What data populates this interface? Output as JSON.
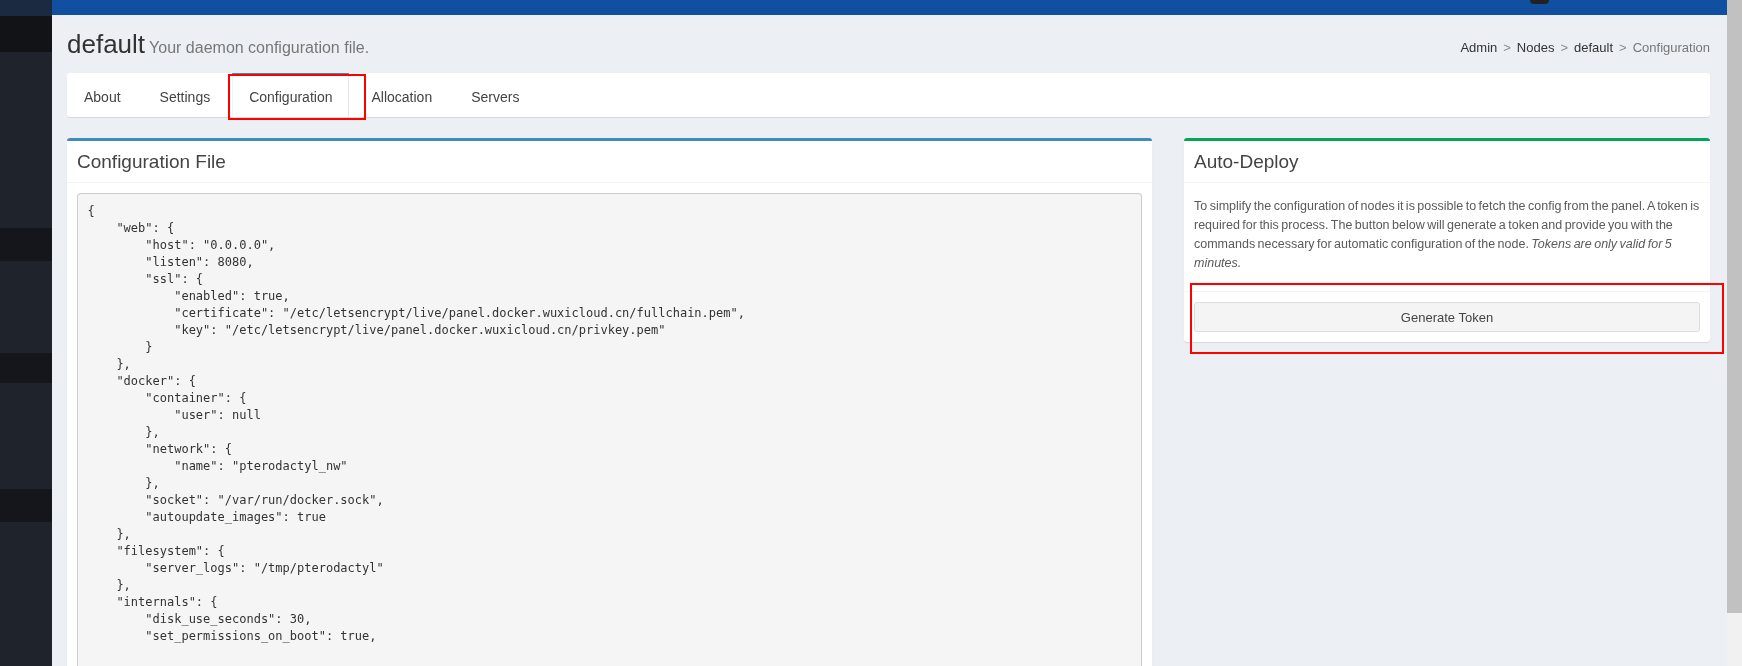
{
  "header": {
    "title": "default",
    "subtitle": "Your daemon configuration file."
  },
  "breadcrumb": [
    {
      "label": "Admin",
      "current": false
    },
    {
      "separator": ">",
      "label": "Nodes",
      "current": false
    },
    {
      "separator": ">",
      "label": "default",
      "current": false
    },
    {
      "separator": ">",
      "label": "Configuration",
      "current": true
    }
  ],
  "tabs": [
    {
      "label": "About",
      "selected": false,
      "highlighted": false
    },
    {
      "label": "Settings",
      "selected": false,
      "highlighted": false
    },
    {
      "label": "Configuration",
      "selected": true,
      "highlighted": true
    },
    {
      "label": "Allocation",
      "selected": false,
      "highlighted": false
    },
    {
      "label": "Servers",
      "selected": false,
      "highlighted": false
    }
  ],
  "config_panel": {
    "title": "Configuration File",
    "code_lines": [
      "{",
      "    \"web\": {",
      "        \"host\": \"0.0.0.0\",",
      "        \"listen\": 8080,",
      "        \"ssl\": {",
      "            \"enabled\": true,",
      "            \"certificate\": \"/etc/letsencrypt/live/panel.docker.wuxicloud.cn/fullchain.pem\",",
      "            \"key\": \"/etc/letsencrypt/live/panel.docker.wuxicloud.cn/privkey.pem\"",
      "        }",
      "    },",
      "    \"docker\": {",
      "        \"container\": {",
      "            \"user\": null",
      "        },",
      "        \"network\": {",
      "            \"name\": \"pterodactyl_nw\"",
      "        },",
      "        \"socket\": \"/var/run/docker.sock\",",
      "        \"autoupdate_images\": true",
      "    },",
      "    \"filesystem\": {",
      "        \"server_logs\": \"/tmp/pterodactyl\"",
      "    },",
      "    \"internals\": {",
      "        \"disk_use_seconds\": 30,",
      "        \"set_permissions_on_boot\": true,"
    ]
  },
  "auto_deploy": {
    "title": "Auto-Deploy",
    "description": "To simplify the configuration of nodes it is possible to fetch the config from the panel. A token is required for this process. The button below will generate a token and provide you with the commands necessary for automatic configuration of the node. *Tokens are only valid for 5 minutes.*",
    "button": {
      "label": "Generate Token",
      "highlighted": true
    }
  }
}
